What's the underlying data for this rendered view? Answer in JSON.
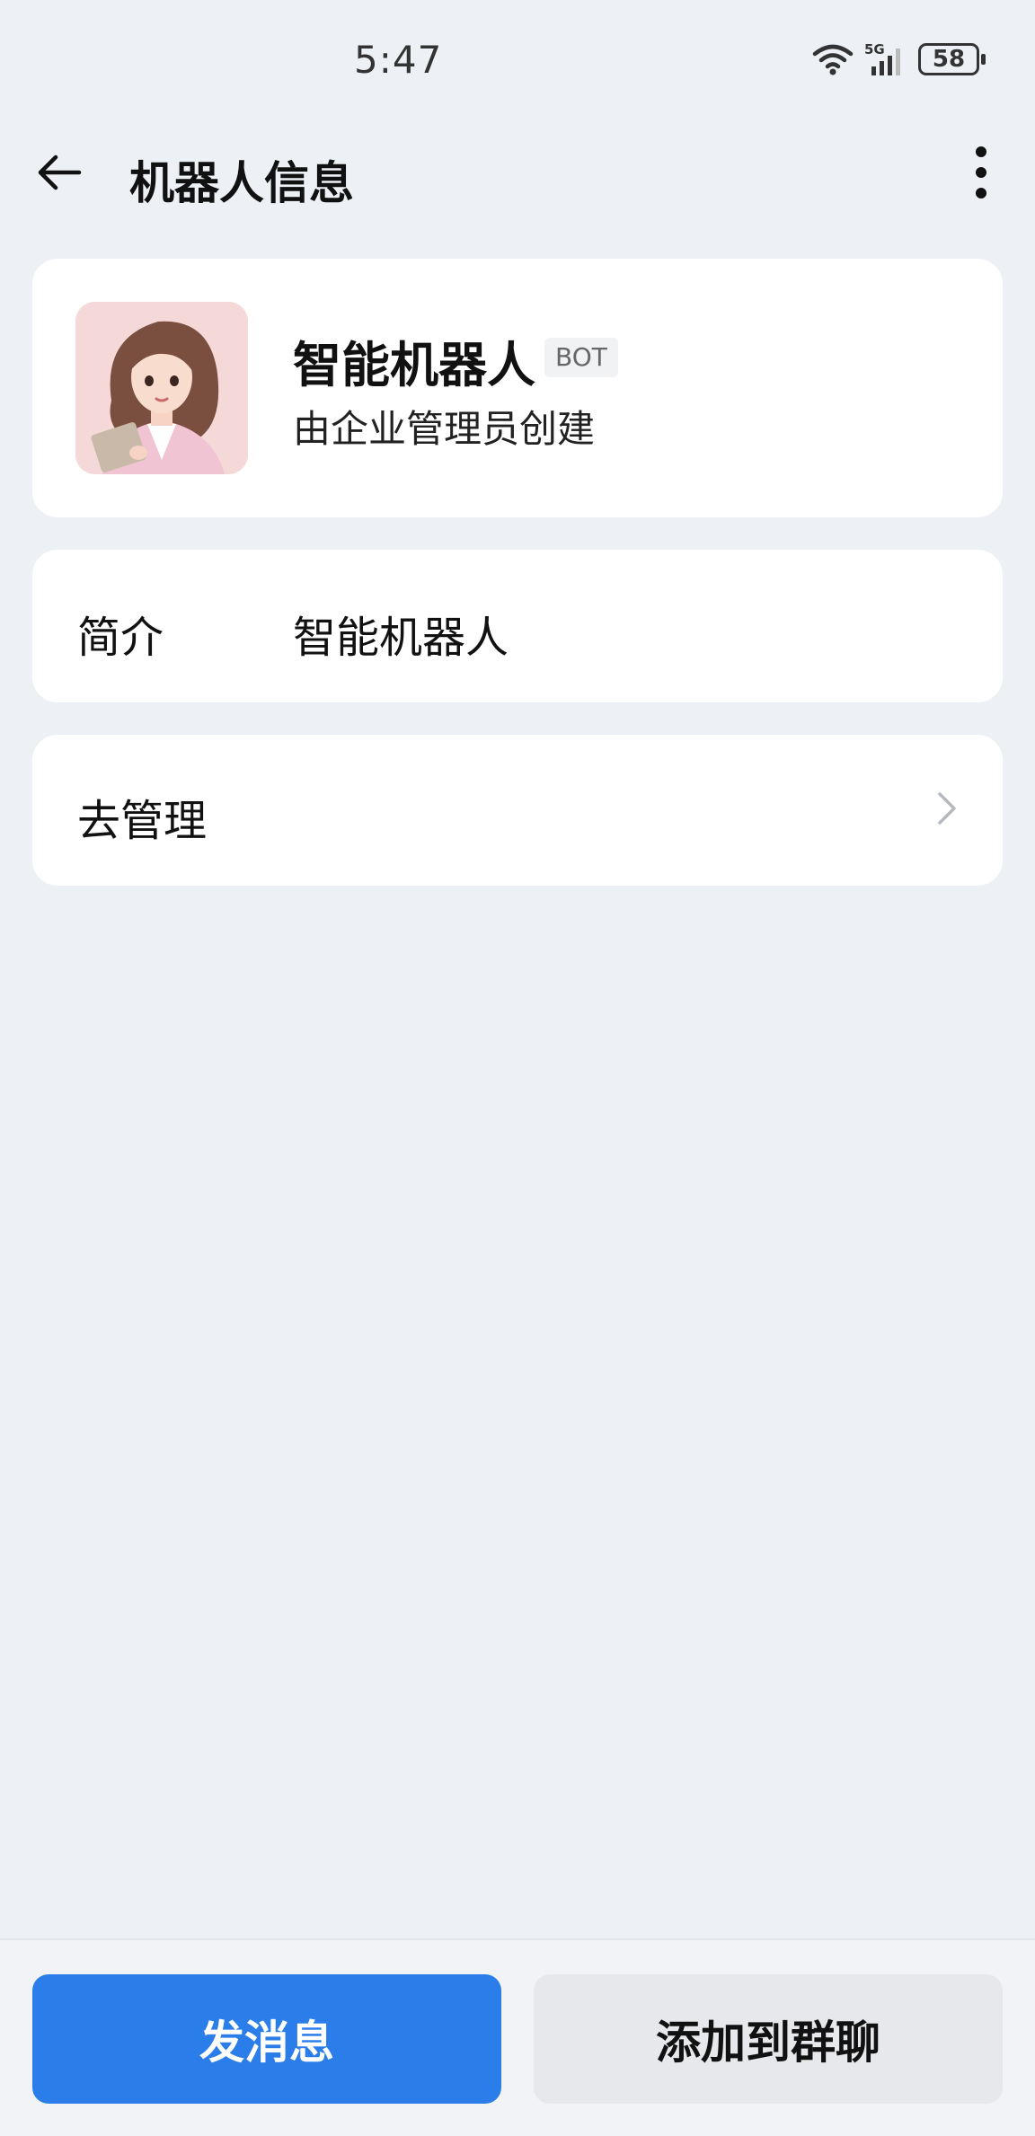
{
  "status_bar": {
    "time": "5:47",
    "network": "5G",
    "battery": "58"
  },
  "app_bar": {
    "title": "机器人信息"
  },
  "profile": {
    "name": "智能机器人",
    "badge": "BOT",
    "creator": "由企业管理员创建"
  },
  "intro": {
    "label": "简介",
    "value": "智能机器人"
  },
  "manage": {
    "label": "去管理"
  },
  "actions": {
    "send_label": "发消息",
    "add_label": "添加到群聊"
  },
  "colors": {
    "primary": "#2b7de9",
    "background": "#edf0f5",
    "card": "#ffffff"
  }
}
